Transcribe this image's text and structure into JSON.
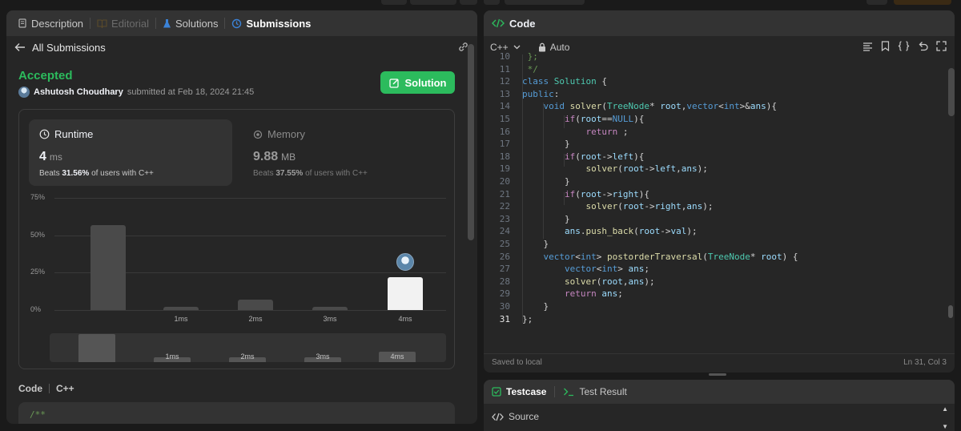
{
  "left_tabs": [
    {
      "label": "Description",
      "state": "normal"
    },
    {
      "label": "Editorial",
      "state": "disabled"
    },
    {
      "label": "Solutions",
      "state": "normal"
    },
    {
      "label": "Submissions",
      "state": "active"
    }
  ],
  "subheader": {
    "title": "All Submissions"
  },
  "result": {
    "status": "Accepted",
    "user": "Ashutosh Choudhary",
    "submitted_text": "submitted at Feb 18, 2024 21:45",
    "solution_button": "Solution"
  },
  "runtime": {
    "title": "Runtime",
    "value": "4",
    "unit": "ms",
    "beats_prefix": "Beats",
    "beats_value": "31.56%",
    "beats_suffix": "of users with C++"
  },
  "memory": {
    "title": "Memory",
    "value": "9.88",
    "unit": "MB",
    "beats_prefix": "Beats",
    "beats_value": "37.55%",
    "beats_suffix": "of users with C++"
  },
  "chart_data": {
    "type": "bar",
    "categories": [
      "",
      "1ms",
      "2ms",
      "3ms",
      "4ms"
    ],
    "values": [
      57,
      2,
      7,
      2,
      22
    ],
    "highlight_index": 4,
    "ylim": [
      0,
      75
    ],
    "yticks": [
      "75%",
      "50%",
      "25%",
      "0%"
    ],
    "grid": true
  },
  "minimap": {
    "labels": [
      "1ms",
      "2ms",
      "3ms",
      "4ms"
    ]
  },
  "code_section": {
    "title": "Code",
    "language": "C++",
    "preview": "/**"
  },
  "right_panel": {
    "title": "Code",
    "language": "C++",
    "mode": "Auto",
    "saved": "Saved to local",
    "cursor": "Ln 31, Col 3"
  },
  "code_lines": [
    {
      "n": "10",
      "text": " };"
    },
    {
      "n": "11",
      "text": " */"
    },
    {
      "n": "12",
      "text": "class Solution {"
    },
    {
      "n": "13",
      "text": "public:"
    },
    {
      "n": "14",
      "text": "    void solver(TreeNode* root,vector<int>&ans){"
    },
    {
      "n": "15",
      "text": "        if(root==NULL){"
    },
    {
      "n": "16",
      "text": "            return ;"
    },
    {
      "n": "17",
      "text": "        }"
    },
    {
      "n": "18",
      "text": "        if(root->left){"
    },
    {
      "n": "19",
      "text": "            solver(root->left,ans);"
    },
    {
      "n": "20",
      "text": "        }"
    },
    {
      "n": "21",
      "text": "        if(root->right){"
    },
    {
      "n": "22",
      "text": "            solver(root->right,ans);"
    },
    {
      "n": "23",
      "text": "        }"
    },
    {
      "n": "24",
      "text": "        ans.push_back(root->val);"
    },
    {
      "n": "25",
      "text": "    }"
    },
    {
      "n": "26",
      "text": "    vector<int> postorderTraversal(TreeNode* root) {"
    },
    {
      "n": "27",
      "text": "        vector<int> ans;"
    },
    {
      "n": "28",
      "text": "        solver(root,ans);"
    },
    {
      "n": "29",
      "text": "        return ans;"
    },
    {
      "n": "30",
      "text": "    }"
    },
    {
      "n": "31",
      "text": "};"
    }
  ],
  "bottom_panel": {
    "tab_testcase": "Testcase",
    "tab_result": "Test Result",
    "source": "Source"
  },
  "colors": {
    "accent_green": "#2cbb5d",
    "panel_bg": "#262626",
    "header_bg": "#333333",
    "page_bg": "#1a1a1a"
  },
  "icons": [
    "description-icon",
    "editorial-icon",
    "solutions-flask-icon",
    "submissions-history-icon",
    "back-arrow-icon",
    "link-icon",
    "edit-icon",
    "clock-icon",
    "memory-chip-icon",
    "code-brackets-icon",
    "chevron-down-icon",
    "lock-icon",
    "menu-icon",
    "bookmark-icon",
    "braces-icon",
    "undo-icon",
    "expand-icon",
    "checkbox-icon",
    "terminal-icon"
  ]
}
